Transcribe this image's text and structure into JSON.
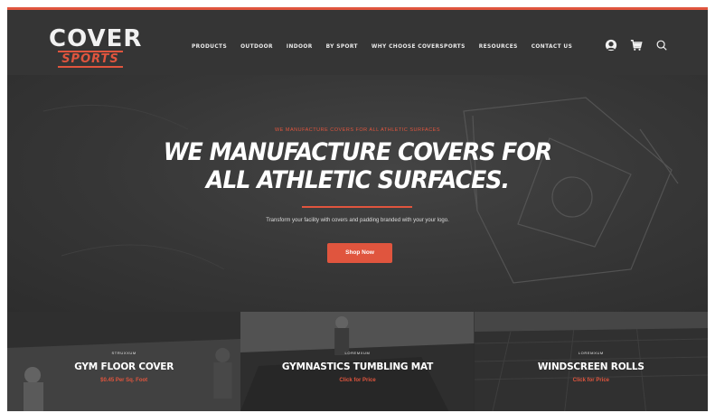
{
  "brand": {
    "logo_top": "COVER",
    "logo_bottom": "SPORTS",
    "accent_color": "#e0553e"
  },
  "nav": {
    "items": [
      {
        "label": "PRODUCTS"
      },
      {
        "label": "OUTDOOR"
      },
      {
        "label": "INDOOR"
      },
      {
        "label": "BY SPORT"
      },
      {
        "label": "WHY CHOOSE COVERSPORTS"
      },
      {
        "label": "RESOURCES"
      },
      {
        "label": "CONTACT US"
      }
    ],
    "icons": [
      "account-icon",
      "cart-icon",
      "search-icon"
    ]
  },
  "hero": {
    "eyebrow": "WE MANUFACTURE COVERS FOR ALL ATHLETIC SURFACES",
    "headline_line1": "WE MANUFACTURE COVERS FOR",
    "headline_line2": "ALL ATHLETIC SURFACES.",
    "subtext": "Transform your facility with covers and padding branded with your your logo.",
    "cta_label": "Shop Now"
  },
  "tiles": [
    {
      "eyebrow": "STRUXXUM",
      "title": "GYM FLOOR COVER",
      "price": "$0.45 Per Sq. Foot"
    },
    {
      "eyebrow": "LOREMXUM",
      "title": "GYMNASTICS TUMBLING MAT",
      "price": "Click for Price"
    },
    {
      "eyebrow": "LOREMXUM",
      "title": "WINDSCREEN ROLLS",
      "price": "Click for Price"
    }
  ]
}
